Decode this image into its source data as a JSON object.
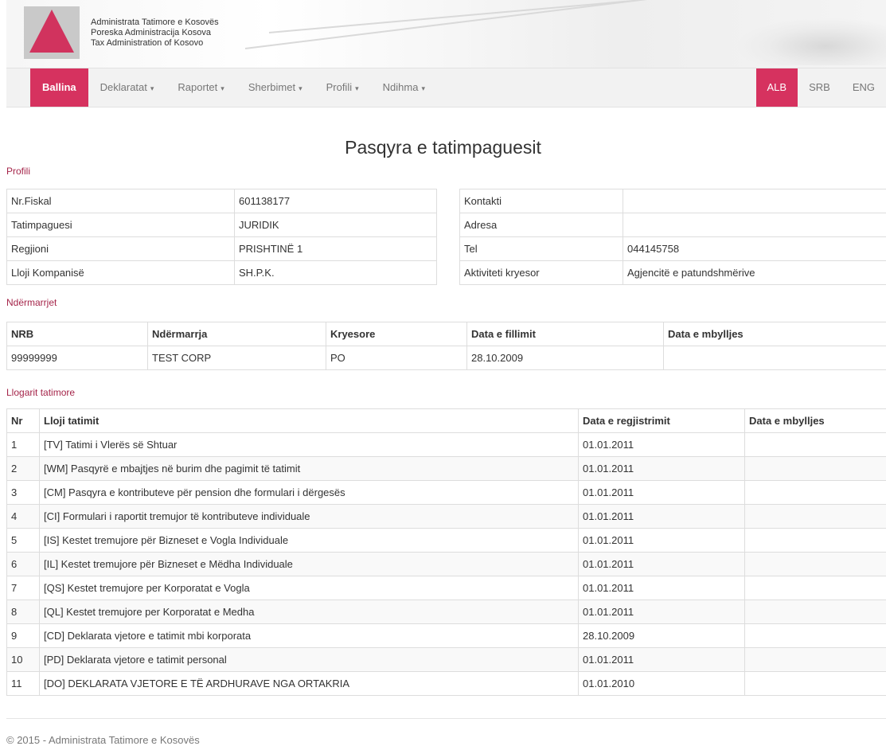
{
  "org": {
    "line1": "Administrata Tatimore e Kosovës",
    "line2": "Poreska Administracija Kosova",
    "line3": "Tax Administration of Kosovo"
  },
  "nav": {
    "items": [
      {
        "label": "Ballina",
        "dropdown": false
      },
      {
        "label": "Deklaratat",
        "dropdown": true
      },
      {
        "label": "Raportet",
        "dropdown": true
      },
      {
        "label": "Sherbimet",
        "dropdown": true
      },
      {
        "label": "Profili",
        "dropdown": true
      },
      {
        "label": "Ndihma",
        "dropdown": true
      }
    ],
    "caret": "▾",
    "languages": [
      "ALB",
      "SRB",
      "ENG"
    ]
  },
  "page_title": "Pasqyra e tatimpaguesit",
  "profile": {
    "label": "Profili",
    "left": [
      [
        "Nr.Fiskal",
        "601138177"
      ],
      [
        "Tatimpaguesi",
        "JURIDIK"
      ],
      [
        "Regjioni",
        "PRISHTINË 1"
      ],
      [
        "Lloji Kompanisë",
        "SH.P.K."
      ]
    ],
    "right": [
      [
        "Kontakti",
        ""
      ],
      [
        "Adresa",
        ""
      ],
      [
        "Tel",
        "044145758"
      ],
      [
        "Aktiviteti kryesor",
        "Agjencitë e patundshmërive"
      ]
    ]
  },
  "enterprises": {
    "label": "Ndërmarrjet",
    "headers": [
      "NRB",
      "Ndërmarrja",
      "Kryesore",
      "Data e fillimit",
      "Data e mbylljes"
    ],
    "rows": [
      [
        "99999999",
        "TEST CORP",
        "PO",
        "28.10.2009",
        ""
      ]
    ]
  },
  "tax_accounts": {
    "label": "Llogarit tatimore",
    "headers": [
      "Nr",
      "Lloji tatimit",
      "Data e regjistrimit",
      "Data e mbylljes"
    ],
    "rows": [
      [
        "1",
        "[TV] Tatimi i Vlerës së Shtuar",
        "01.01.2011",
        ""
      ],
      [
        "2",
        "[WM] Pasqyrë e mbajtjes në burim dhe pagimit të tatimit",
        "01.01.2011",
        ""
      ],
      [
        "3",
        "[CM] Pasqyra e kontributeve për pension dhe formulari i dërgesës",
        "01.01.2011",
        ""
      ],
      [
        "4",
        "[CI] Formulari i raportit tremujor të kontributeve individuale",
        "01.01.2011",
        ""
      ],
      [
        "5",
        "[IS] Kestet tremujore për Bizneset e Vogla Individuale",
        "01.01.2011",
        ""
      ],
      [
        "6",
        "[IL] Kestet tremujore për Bizneset e Mëdha Individuale",
        "01.01.2011",
        ""
      ],
      [
        "7",
        "[QS] Kestet tremujore per Korporatat e Vogla",
        "01.01.2011",
        ""
      ],
      [
        "8",
        "[QL] Kestet tremujore per Korporatat e Medha",
        "01.01.2011",
        ""
      ],
      [
        "9",
        "[CD] Deklarata vjetore e tatimit mbi korporata",
        "28.10.2009",
        ""
      ],
      [
        "10",
        "[PD] Deklarata vjetore e tatimit personal",
        "01.01.2011",
        ""
      ],
      [
        "11",
        "[DO] DEKLARATA VJETORE E TË ARDHURAVE NGA ORTAKRIA",
        "01.01.2010",
        ""
      ]
    ]
  },
  "footer": "© 2015 - Administrata Tatimore e Kosovës",
  "colors": {
    "accent": "#d6325f",
    "section": "#a5254a"
  }
}
